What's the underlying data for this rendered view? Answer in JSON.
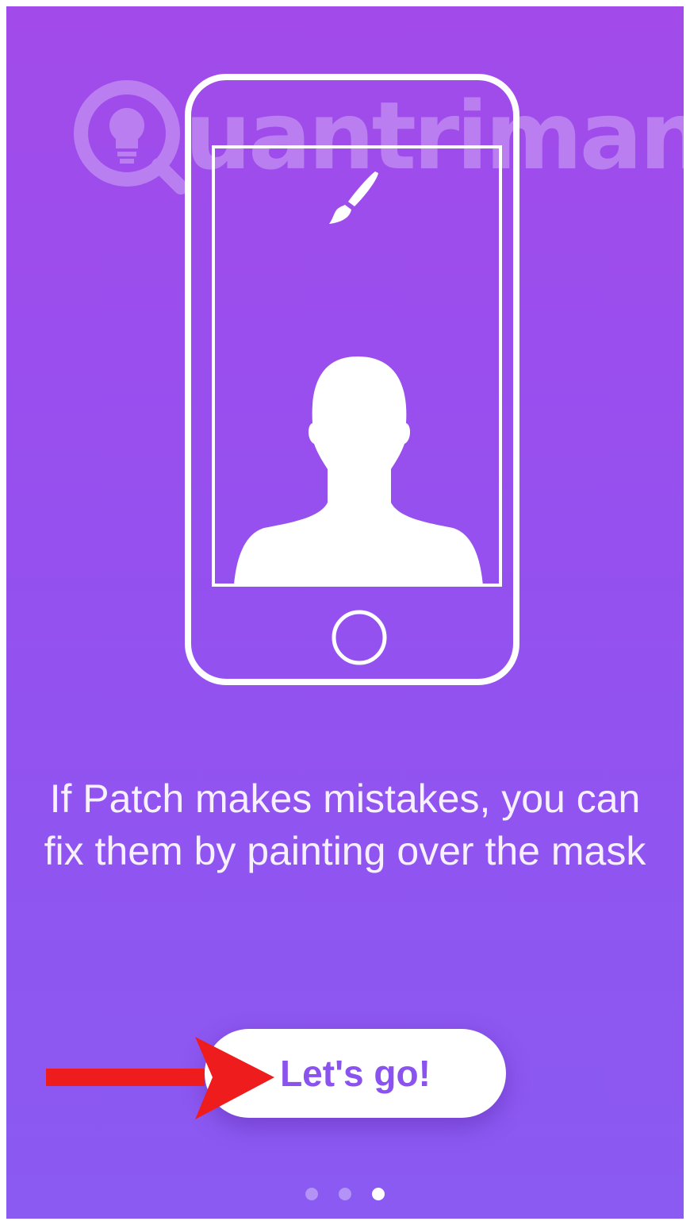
{
  "watermark": {
    "text": "uantrimang"
  },
  "onboarding": {
    "message": "If Patch makes mistakes, you can fix them by painting over the mask",
    "cta_label": "Let's go!",
    "page_indicator": {
      "total": 3,
      "current": 3
    }
  },
  "icons": {
    "phone": "phone-outline-icon",
    "brush": "paintbrush-icon",
    "person": "person-silhouette-icon",
    "home_button": "home-button-icon",
    "arrow": "red-arrow-annotation-icon",
    "logo": "lightbulb-logo-icon"
  },
  "colors": {
    "background_top": "#a24bea",
    "background_bottom": "#8a5af2",
    "button_text": "#8a52ee",
    "arrow": "#ee1c1c"
  }
}
